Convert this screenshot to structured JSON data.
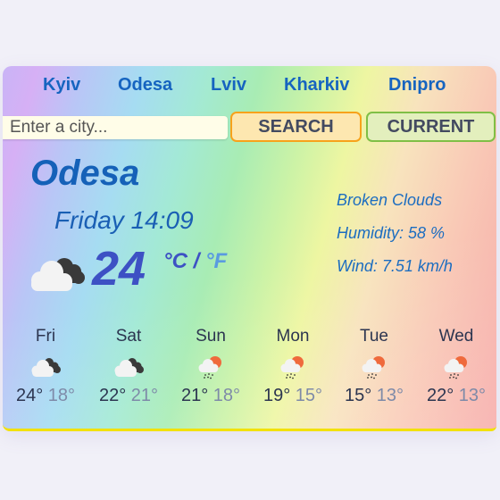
{
  "nav": {
    "cities": [
      "Kyiv",
      "Odesa",
      "Lviv",
      "Kharkiv",
      "Dnipro"
    ]
  },
  "search": {
    "placeholder": "Enter a city...",
    "value": "",
    "search_label": "SEARCH",
    "current_label": "CURRENT"
  },
  "current": {
    "city": "Odesa",
    "datetime": "Friday 14:09",
    "icon": "broken-clouds-icon",
    "temperature": "24",
    "unit_c": "°C",
    "unit_separator": "/",
    "unit_f": "°F",
    "description": "Broken Clouds",
    "humidity": "Humidity: 58 %",
    "wind": "Wind: 7.51 km/h"
  },
  "forecast": [
    {
      "day": "Fri",
      "icon": "broken-clouds-icon",
      "max": "24°",
      "min": "18°"
    },
    {
      "day": "Sat",
      "icon": "broken-clouds-icon",
      "max": "22°",
      "min": "21°"
    },
    {
      "day": "Sun",
      "icon": "rain-sun-icon",
      "max": "21°",
      "min": "18°"
    },
    {
      "day": "Mon",
      "icon": "rain-sun-icon",
      "max": "19°",
      "min": "15°"
    },
    {
      "day": "Tue",
      "icon": "rain-sun-icon",
      "max": "15°",
      "min": "13°"
    },
    {
      "day": "Wed",
      "icon": "rain-sun-icon",
      "max": "22°",
      "min": "13°"
    }
  ],
  "colors": {
    "nav_link": "#1664c0",
    "search_bg": "#fde7b0",
    "search_border": "#f7a21b",
    "current_bg": "#e3efbd",
    "current_border": "#7fbf46",
    "temperature": "#3d51c4",
    "sun": "#ef6a3c"
  }
}
